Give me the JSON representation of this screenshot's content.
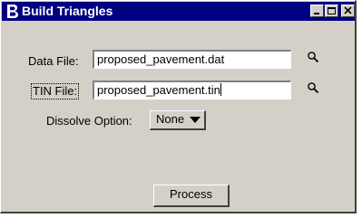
{
  "window": {
    "title": "Build Triangles",
    "icon": "bentley-b-icon",
    "controls": [
      "minimize-icon",
      "maximize-icon",
      "close-icon"
    ]
  },
  "form": {
    "data_file": {
      "label": "Data File:",
      "value": "proposed_pavement.dat",
      "browse_icon": "magnifier-icon"
    },
    "tin_file": {
      "label": "TIN File:",
      "value": "proposed_pavement.tin",
      "browse_icon": "magnifier-icon"
    },
    "dissolve_option": {
      "label": "Dissolve Option:",
      "selected": "None"
    },
    "process_label": "Process"
  },
  "colors": {
    "titlebar": "#000080",
    "title_text": "#ffffff",
    "face": "#d4d0c8",
    "field": "#ffffff"
  }
}
